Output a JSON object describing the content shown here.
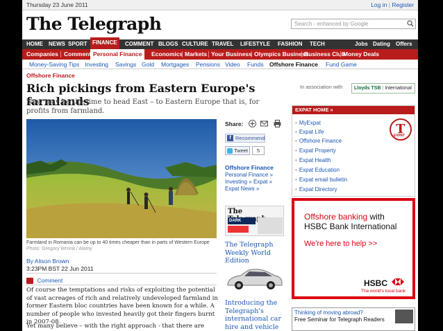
{
  "topbar": {
    "date": "Thursday 23 June 2011",
    "login": "Log in",
    "separator": "|",
    "register": "Register"
  },
  "masthead": {
    "logo": "The Telegraph",
    "search_placeholder": "Search - enhanced by Google"
  },
  "nav_primary": [
    "HOME",
    "NEWS",
    "SPORT",
    "FINANCE",
    "COMMENT",
    "BLOGS",
    "CULTURE",
    "TRAVEL",
    "LIFESTYLE",
    "FASHION",
    "TECH"
  ],
  "nav_primary_right": [
    "Jobs",
    "Dating",
    "Offers"
  ],
  "nav_secondary": [
    "Companies",
    "Comment",
    "Personal Finance",
    "Economics",
    "Markets",
    "Your Business",
    "Olympics Business",
    "Business Club",
    "Money Deals"
  ],
  "nav_tertiary": [
    "Money-Saving Tips",
    "Investing",
    "Savings",
    "Gold",
    "Mortgages",
    "Pensions",
    "Video",
    "Funds",
    "Offshore Finance",
    "Fund Game"
  ],
  "article": {
    "section": "Offshore Finance",
    "headline": "Rich pickings from Eastern Europe's farmlands",
    "standfirst": "Now may be the time to head East – to Eastern Europe that is, for profits from farmland.",
    "caption": "Farmland in Romania can be up to 40 times cheaper than in parts of Western Europe",
    "credit": "Photo: Gregory Wrona / Alamy",
    "byline": "By Alison Brown",
    "timestamp": "3:23PM BST 22 Jun 2011",
    "comment_label": "Comment",
    "para1": "Of course the temptations and risks of exploiting the potential of vast acreages of rich and relatively undeveloped farmland in former Eastern bloc countries have been known for a while. A number of people who invested heavily got their fingers burnt in 2007-08.",
    "para2": "Yet many believe – with the right approach - that there are great"
  },
  "share": {
    "label": "Share:",
    "recommend": "Recommend",
    "tweet": "Tweet",
    "tweet_count": "5"
  },
  "related": {
    "heading": "Offshore Finance",
    "links": [
      "Personal Finance »",
      "Investing »",
      "Expat »",
      "Expat News »"
    ],
    "promo1_logo": "The Telegraph",
    "promo1_band": "DARK KNIGHT",
    "promo1_title": "The Telegraph Weekly World Edition",
    "promo2_title": "Introducing the Telegraph's international car hire and vehicle rental service"
  },
  "sponsor": {
    "prefix": "In association with",
    "name": "Lloyds TSB",
    "suffix": "International"
  },
  "expat": {
    "heading": "EXPAT HOME »",
    "items": [
      "MyExpat",
      "Expat Life",
      "Offshore Finance",
      "Expat Property",
      "Expat Health",
      "Expat Education",
      "Expat email bulletin",
      "Expat Directory"
    ],
    "badge": "EXPAT"
  },
  "ad_hsbc": {
    "line1_red": "Offshore banking",
    "line1_black": " with",
    "line2": "HSBC Bank International",
    "cta": "We're here to help >>",
    "brand": "HSBC",
    "tagline": "The world's local bank"
  },
  "ad_moving": {
    "line1": "Thinking of moving abroad?",
    "line2": "Free Seminar for Telegraph Readers"
  },
  "colors": {
    "brand_red": "#b91c1c",
    "link_blue": "#1a56b3",
    "hsbc_red": "#db0011"
  }
}
